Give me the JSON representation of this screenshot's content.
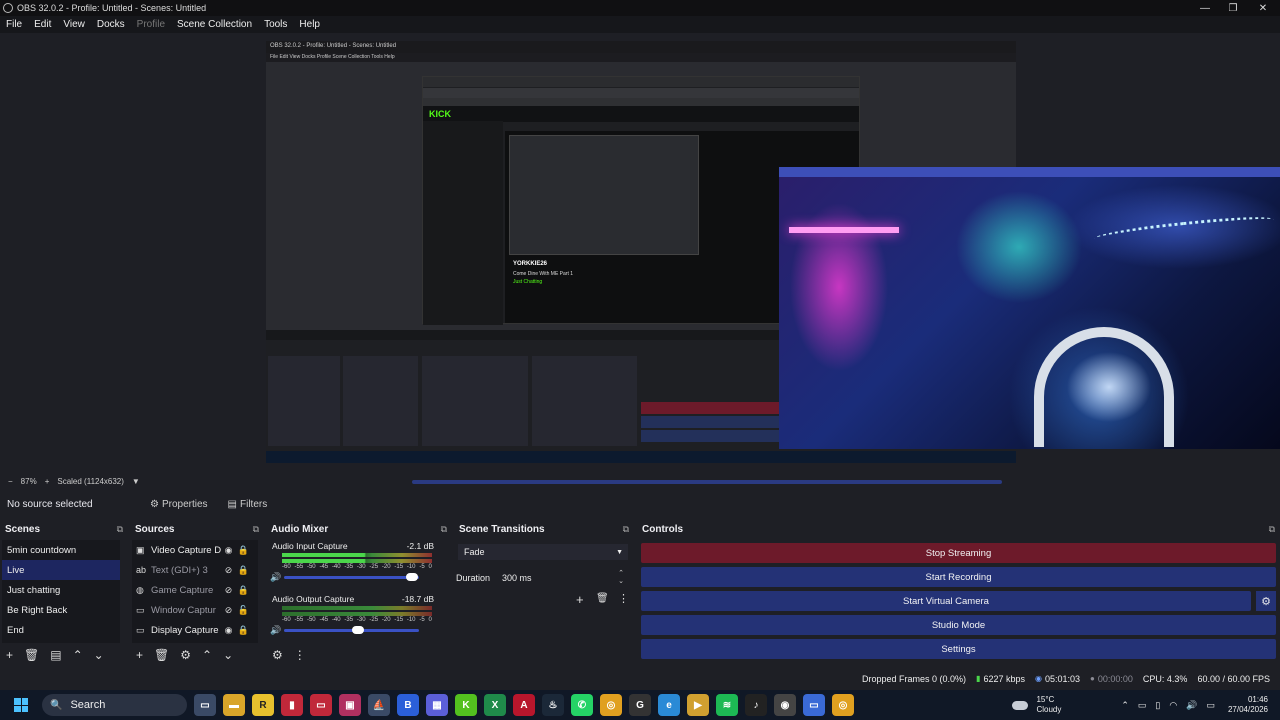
{
  "window": {
    "title": "OBS 32.0.2 - Profile: Untitled - Scenes: Untitled"
  },
  "menu": [
    "File",
    "Edit",
    "View",
    "Docks",
    "Profile",
    "Scene Collection",
    "Tools",
    "Help"
  ],
  "nested_obs": {
    "title": "OBS 32.0.2 - Profile: Untitled - Scenes: Untitled",
    "menu": "File  Edit  View  Docks  Profile  Scene Collection  Tools  Help",
    "site_logo": "KICK",
    "streamer": "YORKKIE26",
    "stream_title": "Come Dine With ME Part 1",
    "category": "Just Chatting"
  },
  "preview_bar": {
    "zoom": "87%",
    "scale": "Scaled (1124x632)"
  },
  "context": {
    "no_source": "No source selected",
    "properties": "Properties",
    "filters": "Filters"
  },
  "scenes": {
    "title": "Scenes",
    "items": [
      "5min countdown",
      "Live",
      "Just chatting",
      "Be Right Back",
      "End"
    ],
    "selected": "Live"
  },
  "sources": {
    "title": "Sources",
    "items": [
      {
        "icon": "camera-icon",
        "name": "Video Capture D"
      },
      {
        "icon": "text-icon",
        "name": "Text (GDI+) 3"
      },
      {
        "icon": "gamepad-icon",
        "name": "Game Capture"
      },
      {
        "icon": "window-icon",
        "name": "Window Captur"
      },
      {
        "icon": "monitor-icon",
        "name": "Display Capture"
      }
    ]
  },
  "mixer": {
    "title": "Audio Mixer",
    "channels": [
      {
        "name": "Audio Input Capture",
        "db": "-2.1 dB",
        "volume": 0.95
      },
      {
        "name": "Audio Output Capture",
        "db": "-18.7 dB",
        "volume": 0.55
      }
    ],
    "ticks": [
      "-60",
      "-55",
      "-50",
      "-45",
      "-40",
      "-35",
      "-30",
      "-25",
      "-20",
      "-15",
      "-10",
      "-5",
      "0"
    ]
  },
  "transitions": {
    "title": "Scene Transitions",
    "selected": "Fade",
    "duration_label": "Duration",
    "duration_value": "300 ms"
  },
  "controls": {
    "title": "Controls",
    "buttons": [
      "Stop Streaming",
      "Start Recording",
      "Start Virtual Camera",
      "Studio Mode",
      "Settings"
    ]
  },
  "status": {
    "dropped": "Dropped Frames 0 (0.0%)",
    "bitrate": "6227 kbps",
    "stream_time": "05:01:03",
    "record_time": "00:00:00",
    "cpu": "CPU: 4.3%",
    "fps": "60.00 / 60.00 FPS"
  },
  "taskbar": {
    "search": "Search",
    "weather_temp": "15°C",
    "weather_desc": "Cloudy",
    "time": "01:46",
    "date": "27/04/2026"
  },
  "colors": {
    "accent": "#243276",
    "stop_streaming": "#6d1a2a",
    "selected_scene": "#1d2660",
    "kick_green": "#53fc18"
  }
}
